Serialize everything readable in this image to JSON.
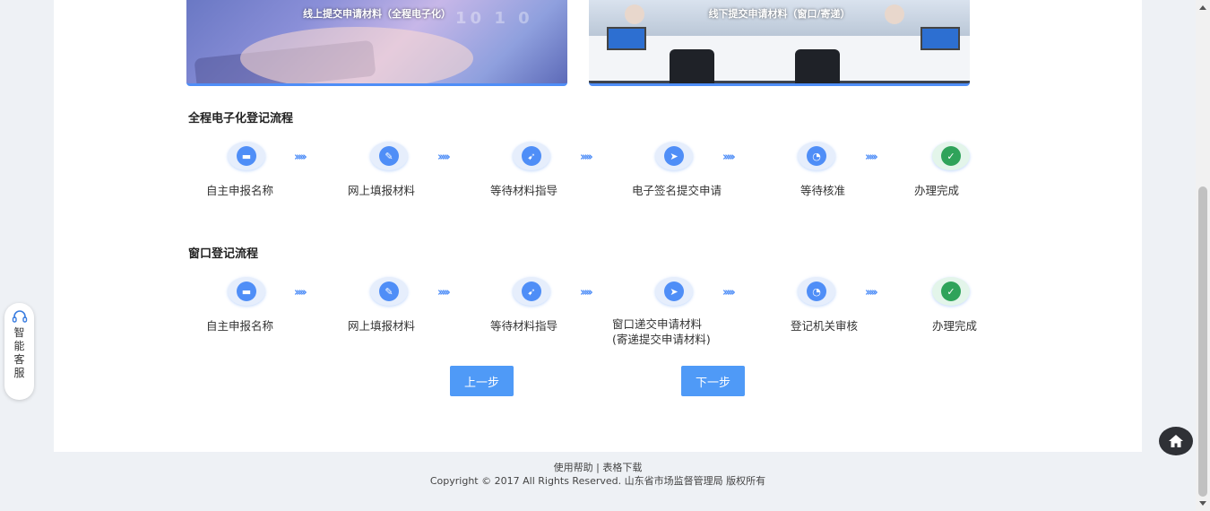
{
  "banners": {
    "online": "线上提交申请材料（全程电子化）",
    "offline": "线下提交申请材料（窗口/寄递）"
  },
  "flow_online": {
    "title": "全程电子化登记流程",
    "steps": [
      "自主申报名称",
      "网上填报材料",
      "等待材料指导",
      "电子签名提交申请",
      "等待核准",
      "办理完成"
    ],
    "icons": [
      "keyboard-icon",
      "pencil-icon",
      "compass-icon",
      "paper-plane-icon",
      "clock-icon",
      "user-check-icon"
    ]
  },
  "flow_window": {
    "title": "窗口登记流程",
    "steps": [
      "自主申报名称",
      "网上填报材料",
      "等待材料指导",
      "窗口递交申请材料",
      "登记机关审核",
      "办理完成"
    ],
    "step4_sub": "(寄递提交申请材料)",
    "icons": [
      "keyboard-icon",
      "pencil-icon",
      "compass-icon",
      "paper-plane-icon",
      "clock-icon",
      "user-check-icon"
    ]
  },
  "buttons": {
    "prev": "上一步",
    "next": "下一步"
  },
  "footer": {
    "help": "使用帮助",
    "separator": "|",
    "download": "表格下载",
    "copyright": "Copyright © 2017 All Rights Reserved. 山东省市场监督管理局 版权所有"
  },
  "side_service": {
    "label": "智能客服"
  },
  "colors": {
    "accent": "#4f8ef7",
    "done": "#2fa35a"
  }
}
